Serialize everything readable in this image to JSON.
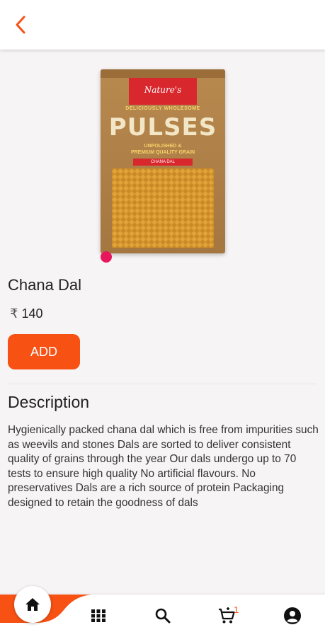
{
  "product": {
    "name": "Chana Dal",
    "currency_symbol": "₹",
    "price": "140",
    "add_label": "ADD",
    "image": {
      "brand": "Nature's",
      "tagline": "DELICIOUSLY WHOLESOME",
      "title": "PULSES",
      "subtitle_line1": "UNPOLISHED &",
      "subtitle_line2": "PREMIUM QUALITY GRAIN",
      "variant": "CHANA DAL"
    }
  },
  "description": {
    "heading": "Description",
    "text": "Hygienically packed chana dal which is free from impurities such as weevils and stones Dals are sorted to deliver consistent quality of grains through the year Our dals undergo up to 70 tests to ensure high quality No artificial flavours. No preservatives Dals are a rich source of protein Packaging designed to retain the goodness of dals"
  },
  "nav": {
    "cart_count": "1",
    "items": [
      "home-icon",
      "grid-icon",
      "search-icon",
      "cart-icon",
      "account-icon"
    ]
  },
  "colors": {
    "accent": "#f75113",
    "dot": "#e8175d",
    "background": "#f7f4f6"
  }
}
